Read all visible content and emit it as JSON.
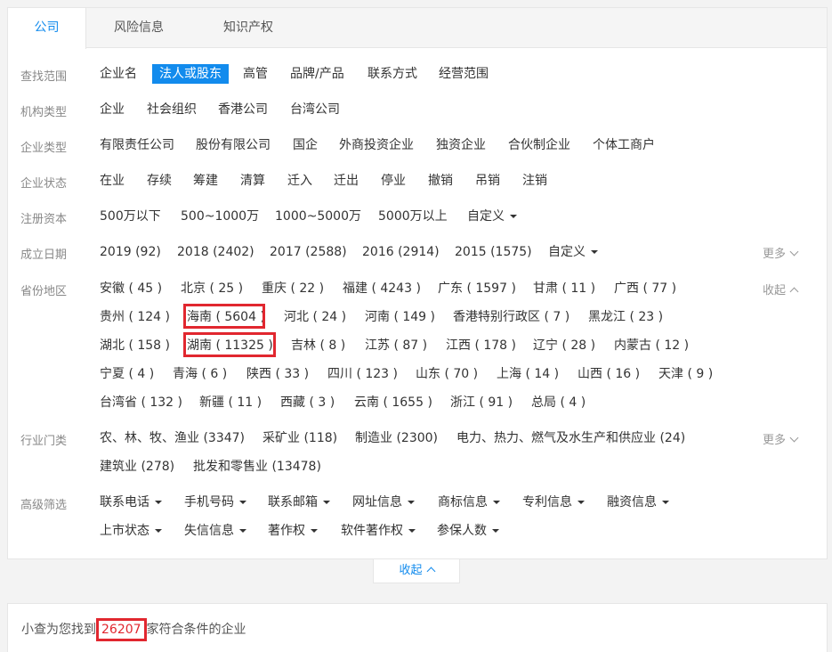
{
  "tabs": [
    "公司",
    "风险信息",
    "知识产权"
  ],
  "filters": {
    "scope": {
      "label": "查找范围",
      "options": [
        "企业名",
        "法人或股东",
        "高管",
        "品牌/产品",
        "联系方式",
        "经营范围"
      ],
      "selected": "法人或股东"
    },
    "org_type": {
      "label": "机构类型",
      "options": [
        "企业",
        "社会组织",
        "香港公司",
        "台湾公司"
      ]
    },
    "company_type": {
      "label": "企业类型",
      "options": [
        "有限责任公司",
        "股份有限公司",
        "国企",
        "外商投资企业",
        "独资企业",
        "合伙制企业",
        "个体工商户"
      ]
    },
    "status": {
      "label": "企业状态",
      "options": [
        "在业",
        "存续",
        "筹建",
        "清算",
        "迁入",
        "迁出",
        "停业",
        "撤销",
        "吊销",
        "注销"
      ]
    },
    "capital": {
      "label": "注册资本",
      "options": [
        "500万以下",
        "500~1000万",
        "1000~5000万",
        "5000万以上",
        "自定义"
      ]
    },
    "founded": {
      "label": "成立日期",
      "options": [
        "2019 (92)",
        "2018 (2402)",
        "2017 (2588)",
        "2016 (2914)",
        "2015 (1575)",
        "自定义"
      ],
      "more": "更多"
    },
    "region": {
      "label": "省份地区",
      "collapse": "收起",
      "rows": [
        [
          "安徽 ( 45 )",
          "北京 ( 25 )",
          "重庆 ( 22 )",
          "福建 ( 4243 )",
          "广东 ( 1597 )",
          "甘肃 ( 11 )",
          "广西 ( 77 )"
        ],
        [
          "贵州 ( 124 )",
          "海南 ( 5604 )",
          "河北 ( 24 )",
          "河南 ( 149 )",
          "香港特别行政区 ( 7 )",
          "黑龙江 ( 23 )"
        ],
        [
          "湖北 ( 158 )",
          "湖南 ( 11325 )",
          "吉林 ( 8 )",
          "江苏 ( 87 )",
          "江西 ( 178 )",
          "辽宁 ( 28 )",
          "内蒙古 ( 12 )"
        ],
        [
          "宁夏 ( 4 )",
          "青海 ( 6 )",
          "陕西 ( 33 )",
          "四川 ( 123 )",
          "山东 ( 70 )",
          "上海 ( 14 )",
          "山西 ( 16 )",
          "天津 ( 9 )"
        ],
        [
          "台湾省 ( 132 )",
          "新疆 ( 11 )",
          "西藏 ( 3 )",
          "云南 ( 1655 )",
          "浙江 ( 91 )",
          "总局 ( 4 )"
        ]
      ]
    },
    "industry": {
      "label": "行业门类",
      "more": "更多",
      "rows": [
        [
          "农、林、牧、渔业 (3347)",
          "采矿业 (118)",
          "制造业 (2300)",
          "电力、热力、燃气及水生产和供应业 (24)"
        ],
        [
          "建筑业 (278)",
          "批发和零售业 (13478)"
        ]
      ]
    },
    "advanced": {
      "label": "高级筛选",
      "rows": [
        [
          "联系电话",
          "手机号码",
          "联系邮箱",
          "网址信息",
          "商标信息",
          "专利信息",
          "融资信息"
        ],
        [
          "上市状态",
          "失信信息",
          "著作权",
          "软件著作权",
          "参保人数"
        ]
      ]
    }
  },
  "collapse_button": "收起",
  "result": {
    "prefix": "小查为您找到",
    "count": "26207",
    "suffix": "家符合条件的企业"
  },
  "colors": {
    "accent": "#128bed",
    "highlight": "#e1272f"
  }
}
